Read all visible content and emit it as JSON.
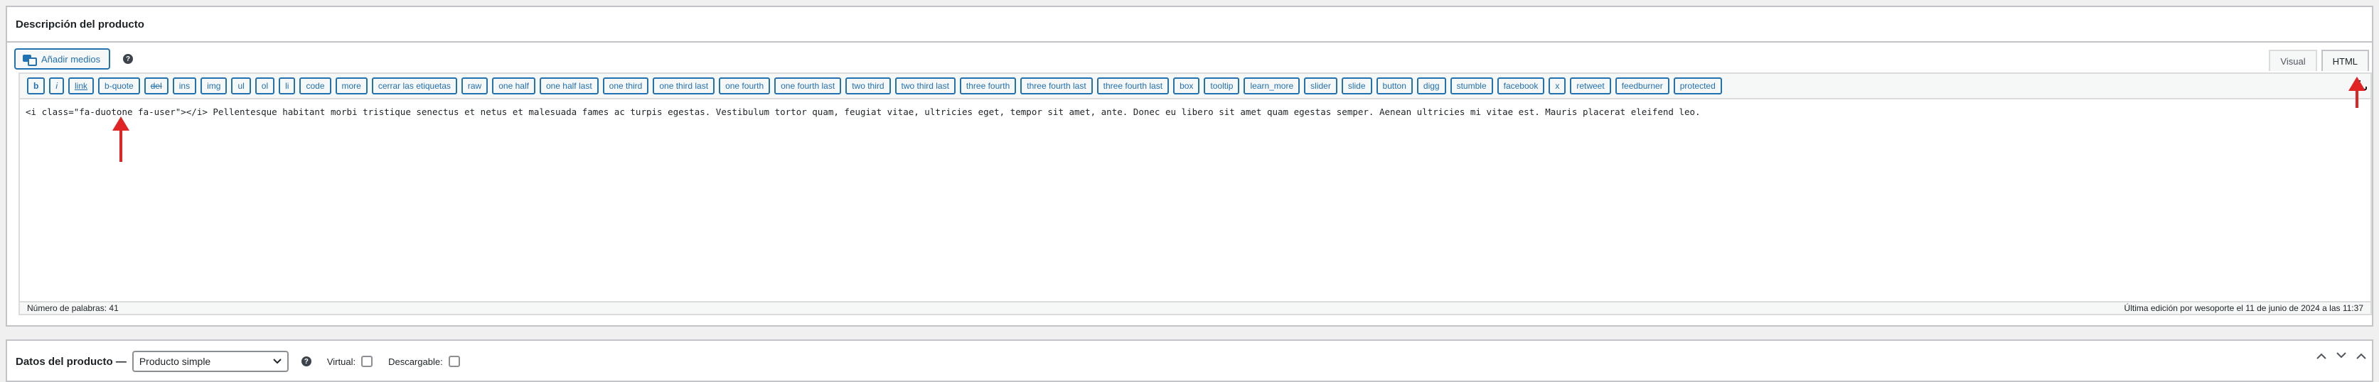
{
  "panel": {
    "title": "Descripción del producto",
    "media_button": "Añadir medios",
    "help_symbol": "?",
    "tabs": {
      "visual": "Visual",
      "html": "HTML"
    }
  },
  "quicktags": [
    {
      "label": "b",
      "style": "bold"
    },
    {
      "label": "i",
      "style": "italic"
    },
    {
      "label": "link",
      "style": "link"
    },
    {
      "label": "b-quote"
    },
    {
      "label": "del",
      "style": "del"
    },
    {
      "label": "ins"
    },
    {
      "label": "img"
    },
    {
      "label": "ul"
    },
    {
      "label": "ol"
    },
    {
      "label": "li"
    },
    {
      "label": "code"
    },
    {
      "label": "more"
    },
    {
      "label": "cerrar las etiquetas"
    },
    {
      "label": "raw"
    },
    {
      "label": "one half"
    },
    {
      "label": "one half last"
    },
    {
      "label": "one third"
    },
    {
      "label": "one third last"
    },
    {
      "label": "one fourth"
    },
    {
      "label": "one fourth last"
    },
    {
      "label": "two third"
    },
    {
      "label": "two third last"
    },
    {
      "label": "three fourth"
    },
    {
      "label": "three fourth last"
    },
    {
      "label": "three fourth last"
    },
    {
      "label": "box"
    },
    {
      "label": "tooltip"
    },
    {
      "label": "learn_more"
    },
    {
      "label": "slider"
    },
    {
      "label": "slide"
    },
    {
      "label": "button"
    },
    {
      "label": "digg"
    },
    {
      "label": "stumble"
    },
    {
      "label": "facebook"
    },
    {
      "label": "x"
    },
    {
      "label": "retweet"
    },
    {
      "label": "feedburner"
    },
    {
      "label": "protected"
    }
  ],
  "editor": {
    "content": "<i class=\"fa-duotone fa-user\"></i> Pellentesque habitant morbi tristique senectus et netus et malesuada fames ac turpis egestas. Vestibulum tortor quam, feugiat vitae, ultricies eget, tempor sit amet, ante. Donec eu libero sit amet quam egestas semper. Aenean ultricies mi vitae est. Mauris placerat eleifend leo.",
    "word_count": "Número de palabras: 41",
    "last_edit": "Última edición por wesoporte el 11 de junio de 2024 a las 11:37"
  },
  "product_data": {
    "label": "Datos del producto —",
    "type_selected": "Producto simple",
    "virtual_label": "Virtual:",
    "download_label": "Descargable:"
  },
  "colors": {
    "accent": "#2271b1",
    "annotation": "#e02424"
  },
  "icons": [
    "media-icon",
    "help-icon",
    "fullscreen-icon",
    "arrow-icon",
    "chevron-down-icon",
    "chevron-up-icon"
  ]
}
